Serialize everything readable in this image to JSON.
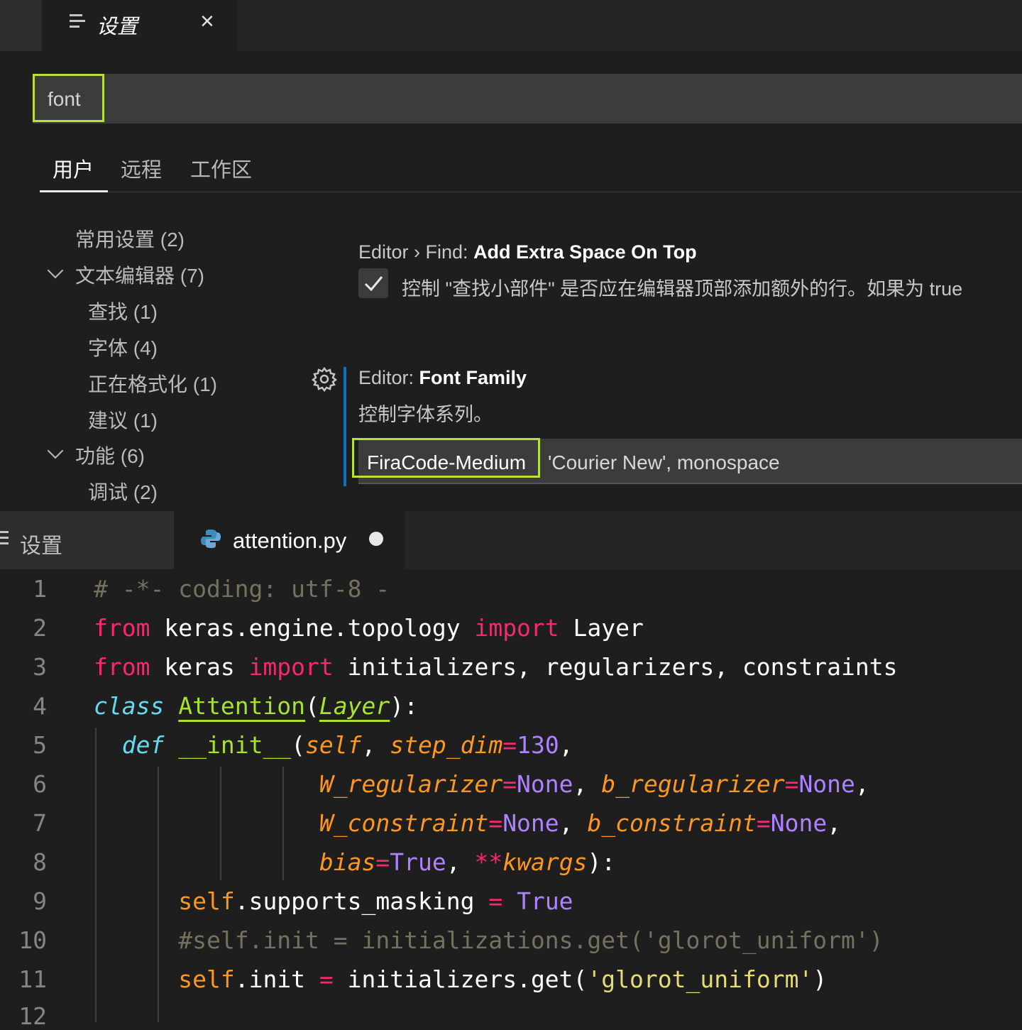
{
  "top_tab": {
    "title": "设置",
    "close_glyph": "×"
  },
  "search": {
    "value": "font"
  },
  "scope_tabs": [
    "用户",
    "远程",
    "工作区"
  ],
  "toc": [
    "常用设置 (2)",
    "文本编辑器 (7)",
    "查找 (1)",
    "字体 (4)",
    "正在格式化 (1)",
    "建议 (1)",
    "功能 (6)",
    "调试 (2)"
  ],
  "find_setting": {
    "category": "Editor › Find: ",
    "name": "Add Extra Space On Top",
    "checked": true,
    "description": "控制 \"查找小部件\" 是否应在编辑器顶部添加额外的行。如果为 true"
  },
  "font_setting": {
    "category": "Editor: ",
    "name": "Font Family",
    "description": "控制字体系列。",
    "value_highlight": "FiraCode-Medium",
    "value_rest": "'Courier New', monospace"
  },
  "editor_tabs": {
    "settings_label": "设置",
    "file_label": "attention.py"
  },
  "line_numbers": [
    "1",
    "2",
    "3",
    "4",
    "5",
    "6",
    "7",
    "8",
    "9",
    "10",
    "11",
    "12"
  ],
  "code": {
    "l1": "# -*- coding: utf-8 -",
    "l2": {
      "kw1": "from",
      "mod": " keras.engine.topology ",
      "kw2": "import",
      "name": " Layer"
    },
    "l3": {
      "kw1": "from",
      "mod": " keras ",
      "kw2": "import",
      "names": " initializers, regularizers, constraints"
    },
    "l4": {
      "kw": "class",
      "cls": "Attention",
      "base": "Layer",
      "open": "(",
      "close": "):"
    },
    "l5": {
      "kw": "def",
      "fn": "__init__",
      "p_self": "self",
      "p_step": "step_dim",
      "v_step": "130"
    },
    "l6": {
      "p1": "W_regularizer",
      "v1": "None",
      "p2": "b_regularizer",
      "v2": "None"
    },
    "l7": {
      "p1": "W_constraint",
      "v1": "None",
      "p2": "b_constraint",
      "v2": "None"
    },
    "l8": {
      "p1": "bias",
      "v1": "True",
      "star": "**",
      "p2": "kwargs",
      "end": "):"
    },
    "l9": {
      "self": "self",
      "attr": ".supports_masking ",
      "eq": "=",
      "val": "True"
    },
    "l10": "#self.init = initializations.get('glorot_uniform')",
    "l11": {
      "self": "self",
      "attr": ".init ",
      "eq": "=",
      "call": " initializers.get(",
      "str": "'glorot_uniform'",
      "end": ")"
    }
  },
  "colors": {
    "highlight": "#b8e03c",
    "accent_bar": "#0e70c0"
  }
}
